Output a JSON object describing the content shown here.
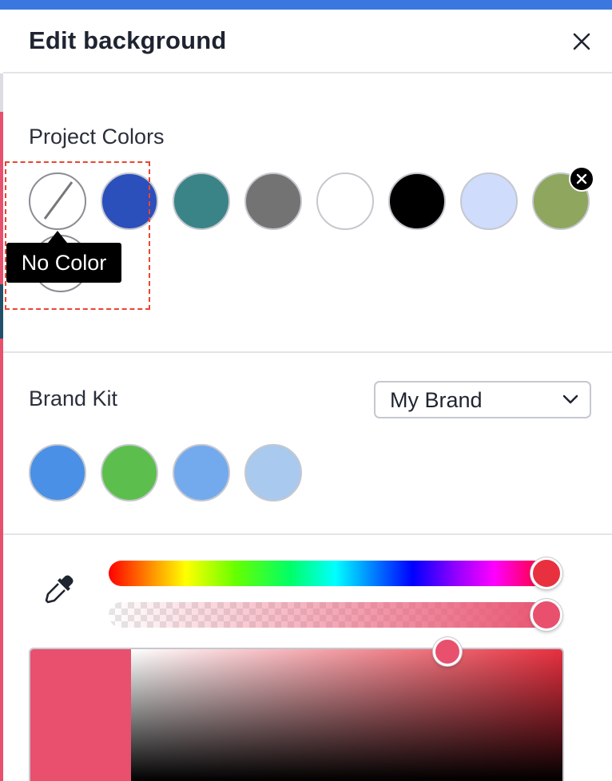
{
  "panel": {
    "title": "Edit background",
    "close_icon": "close-icon"
  },
  "project_colors": {
    "label": "Project Colors",
    "swatches": [
      {
        "name": "no-color",
        "color": "none"
      },
      {
        "name": "blue",
        "color": "#2b4fbb"
      },
      {
        "name": "teal",
        "color": "#3a8487"
      },
      {
        "name": "gray",
        "color": "#737373"
      },
      {
        "name": "white",
        "color": "#ffffff"
      },
      {
        "name": "black",
        "color": "#000000"
      },
      {
        "name": "light-blue",
        "color": "#cfdcfb"
      },
      {
        "name": "olive",
        "color": "#8fa65f"
      }
    ],
    "remove_icon": "close-icon",
    "add_icon": "plus-icon",
    "tooltip": "No Color"
  },
  "brand_kit": {
    "label": "Brand Kit",
    "selected": "My Brand",
    "dropdown_icon": "chevron-down-icon",
    "swatches": [
      {
        "color": "#4a90e6"
      },
      {
        "color": "#5cbf4d"
      },
      {
        "color": "#73aaee"
      },
      {
        "color": "#a9c9ee"
      }
    ]
  },
  "picker": {
    "eyedropper_icon": "eyedropper-icon",
    "current_color": "#e8506e",
    "hue_color": "#e8303f",
    "hue_position": 1.0,
    "alpha": 1.0,
    "saturation": 0.73,
    "brightness": 0.91
  },
  "theme": {
    "accent": "#3a78e0",
    "tooltip_bg": "#000000",
    "highlight": "#e8462f"
  }
}
